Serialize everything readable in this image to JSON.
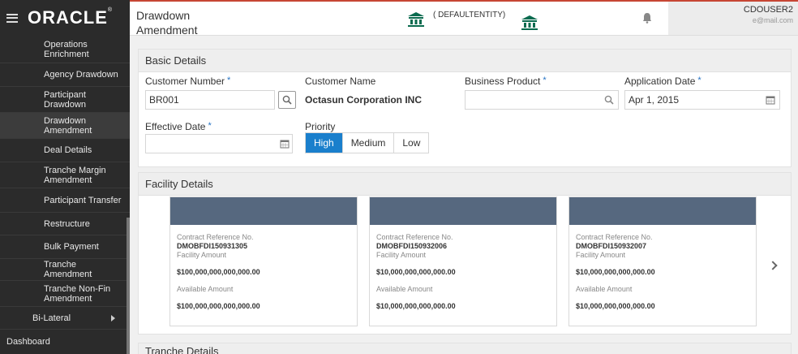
{
  "brand": {
    "logo_text": "ORACLE",
    "trademark": "®"
  },
  "sidebar": {
    "items": [
      {
        "label": "Operations Enrichment"
      },
      {
        "label": "Agency Drawdown"
      },
      {
        "label": "Participant Drawdown"
      },
      {
        "label": "Drawdown Amendment"
      },
      {
        "label": "Deal Details"
      },
      {
        "label": "Tranche Margin Amendment"
      },
      {
        "label": "Participant Transfer"
      },
      {
        "label": "Restructure"
      },
      {
        "label": "Bulk Payment"
      },
      {
        "label": "Tranche Amendment"
      },
      {
        "label": "Tranche Non-Fin Amendment"
      }
    ],
    "parent": {
      "label": "Bi-Lateral"
    },
    "root": {
      "label": "Dashboard"
    }
  },
  "header": {
    "title": "Drawdown Amendment",
    "entity": "( DEFAULTENTITY)",
    "user_name": "CDOUSER2",
    "user_email": "e@mail.com"
  },
  "basic_details": {
    "heading": "Basic Details",
    "customer_number_label": "Customer Number",
    "customer_number_value": "BR001",
    "customer_name_label": "Customer Name",
    "customer_name_value": "Octasun Corporation INC",
    "business_product_label": "Business Product",
    "business_product_value": "",
    "application_date_label": "Application Date",
    "application_date_value": "Apr 1, 2015",
    "effective_date_label": "Effective Date",
    "effective_date_value": "",
    "priority_label": "Priority",
    "priority_options": [
      "High",
      "Medium",
      "Low"
    ],
    "priority_selected": "High",
    "required_mark": "*"
  },
  "facility_details": {
    "heading": "Facility Details",
    "cards": [
      {
        "contract_ref_label": "Contract Reference No.",
        "contract_ref": "DMOBFDI150931305",
        "facility_amount_label": "Facility Amount",
        "facility_amount": "$100,000,000,000,000.00",
        "available_amount_label": "Available Amount",
        "available_amount": "$100,000,000,000,000.00"
      },
      {
        "contract_ref_label": "Contract Reference No.",
        "contract_ref": "DMOBFDI150932006",
        "facility_amount_label": "Facility Amount",
        "facility_amount": "$10,000,000,000,000.00",
        "available_amount_label": "Available Amount",
        "available_amount": "$10,000,000,000,000.00"
      },
      {
        "contract_ref_label": "Contract Reference No.",
        "contract_ref": "DMOBFDI150932007",
        "facility_amount_label": "Facility Amount",
        "facility_amount": "$10,000,000,000,000.00",
        "available_amount_label": "Available Amount",
        "available_amount": "$10,000,000,000,000.00"
      }
    ]
  },
  "tranche_details": {
    "heading": "Tranche Details"
  },
  "colors": {
    "accent": "#1a7fcc",
    "header_teal": "#0a6b4f",
    "sidebar_bg": "#2b2b2b",
    "card_header": "#56687f",
    "oracle_red": "#c74634"
  }
}
